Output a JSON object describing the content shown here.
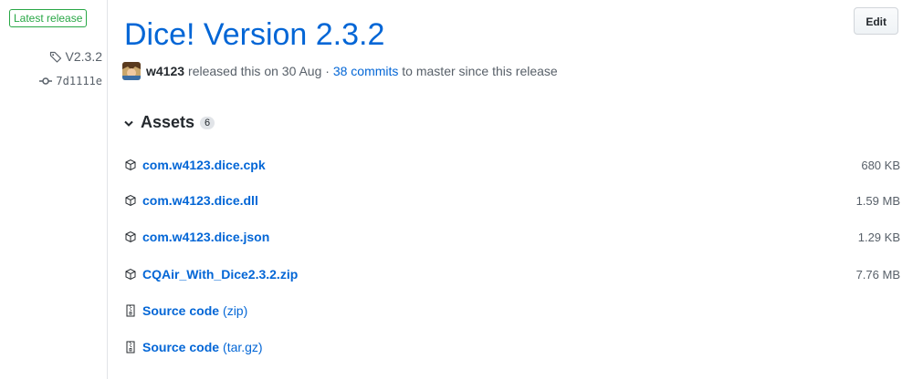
{
  "sidebar": {
    "badge": "Latest release",
    "tag": "V2.3.2",
    "commit": "7d1111e"
  },
  "release": {
    "title": "Dice! Version 2.3.2",
    "edit_label": "Edit",
    "author": "w4123",
    "released_text": "released this on 30 Aug ·",
    "commits_link": "38 commits",
    "commits_suffix": "to master since this release"
  },
  "assets": {
    "label": "Assets",
    "count": "6",
    "items": [
      {
        "name": "com.w4123.dice.cpk",
        "size": "680 KB",
        "icon": "package-icon"
      },
      {
        "name": "com.w4123.dice.dll",
        "size": "1.59 MB",
        "icon": "package-icon"
      },
      {
        "name": "com.w4123.dice.json",
        "size": "1.29 KB",
        "icon": "package-icon"
      },
      {
        "name": "CQAir_With_Dice2.3.2.zip",
        "size": "7.76 MB",
        "icon": "package-icon"
      },
      {
        "name": "Source code",
        "suffix": "(zip)",
        "icon": "file-zip-icon"
      },
      {
        "name": "Source code",
        "suffix": "(tar.gz)",
        "icon": "file-zip-icon"
      }
    ]
  },
  "colors": {
    "link": "#0366d6",
    "badge_green": "#28a745",
    "muted": "#586069"
  }
}
